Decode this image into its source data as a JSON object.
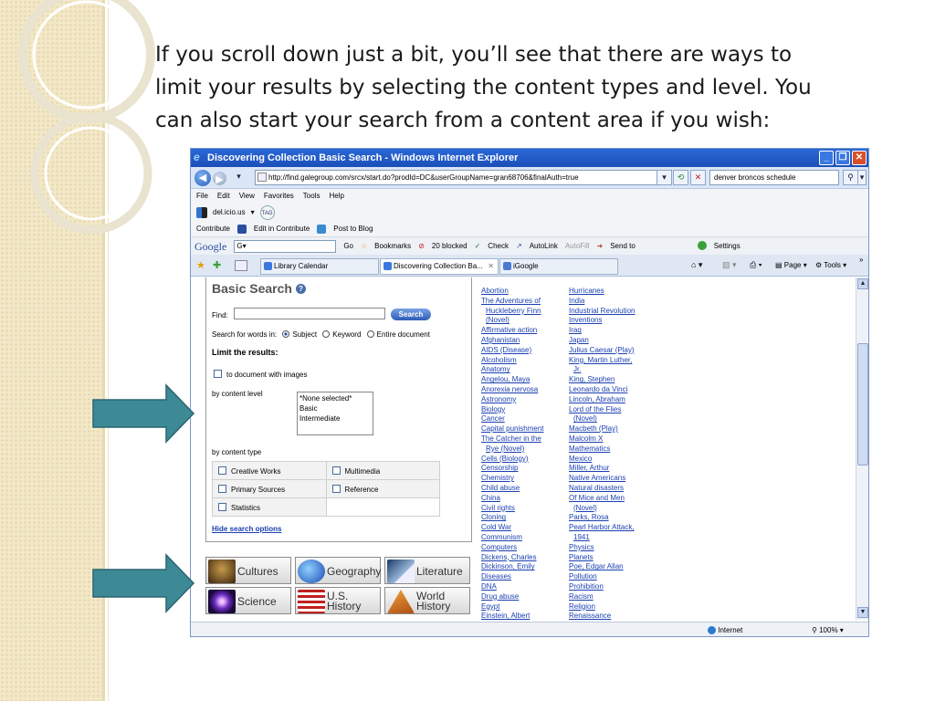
{
  "slide": {
    "title_lines": [
      "If you scroll down just a bit, you’ll see that there are ways to",
      "limit your results by selecting the content types and level. You",
      "can also start your search from a content area if you wish:"
    ]
  },
  "browser": {
    "window_title": "Discovering Collection Basic Search - Windows Internet Explorer",
    "url": "http://find.galegroup.com/srcx/start.do?prodId=DC&userGroupName=gran68706&finalAuth=true",
    "search_value": "denver broncos schedule",
    "menu": [
      "File",
      "Edit",
      "View",
      "Favorites",
      "Tools",
      "Help"
    ],
    "delicious": {
      "label": "del.icio.us",
      "tag": "TAG"
    },
    "contribute": {
      "label": "Contribute",
      "edit": "Edit in Contribute",
      "post": "Post to Blog"
    },
    "google": {
      "logo": "Google",
      "g": "G",
      "go": "Go",
      "bookmarks": "Bookmarks",
      "blocked": "20 blocked",
      "check": "Check",
      "autolink": "AutoLink",
      "autofill": "AutoFill",
      "sendto": "Send to",
      "settings": "Settings"
    },
    "tabs": [
      {
        "label": "Library Calendar"
      },
      {
        "label": "Discovering Collection Ba..."
      },
      {
        "label": "iGoogle"
      }
    ],
    "commands": {
      "page": "Page",
      "tools": "Tools"
    },
    "status": {
      "zone": "Internet",
      "zoom": "100%"
    }
  },
  "form": {
    "title": "Basic Search",
    "find_label": "Find:",
    "search_button": "Search",
    "search_words_in": "Search for words in:",
    "options": [
      "Subject",
      "Keyword",
      "Entire document"
    ],
    "limit_label": "Limit the results:",
    "images_checkbox": "to document with images",
    "level_label": "by content level",
    "levels": [
      "*None selected*",
      "Basic",
      "Intermediate"
    ],
    "type_label": "by content type",
    "types": [
      [
        "Creative Works",
        "Multimedia"
      ],
      [
        "Primary Sources",
        "Reference"
      ],
      [
        "Statistics",
        ""
      ]
    ],
    "hide_link": "Hide search options"
  },
  "categories": [
    {
      "label": "Cultures",
      "color": "#6b4a2a"
    },
    {
      "label": "Geography",
      "color": "#2a63c8"
    },
    {
      "label": "Literature",
      "color": "#3a6aa0"
    },
    {
      "label": "Science",
      "color": "#4a2a8a"
    },
    {
      "label": "U.S.",
      "label2": "History",
      "color": "#b03030"
    },
    {
      "label": "World",
      "label2": "History",
      "color": "#c8702a"
    }
  ],
  "topics_col1": [
    "Abortion",
    "The Adventures of",
    "  Huckleberry Finn",
    "  (Novel)",
    "Affirmative action",
    "Afghanistan",
    "AIDS (Disease)",
    "Alcoholism",
    "Anatomy",
    "Angelou, Maya",
    "Anorexia nervosa",
    "Astronomy",
    "Biology",
    "Cancer",
    "Capital punishment",
    "The Catcher in the",
    "  Rye (Novel)",
    "Cells (Biology)",
    "Censorship",
    "Chemistry",
    "Child abuse",
    "China",
    "Civil rights",
    "Cloning",
    "Cold War",
    "Communism",
    "Computers",
    "Dickens, Charles",
    "Dickinson, Emily",
    "Diseases",
    "DNA",
    "Drug abuse",
    "Egypt",
    "Einstein, Albert"
  ],
  "topics_col2": [
    "Hurricanes",
    "India",
    "Industrial Revolution",
    "Inventions",
    "Iraq",
    "Japan",
    "Julius Caesar (Play)",
    "King, Martin Luther,",
    "  Jr.",
    "King, Stephen",
    "Leonardo da Vinci",
    "Lincoln, Abraham",
    "Lord of the Flies",
    "  (Novel)",
    "Macbeth (Play)",
    "Malcolm X",
    "Mathematics",
    "Mexico",
    "Miller, Arthur",
    "Native Americans",
    "Natural disasters",
    "Of Mice and Men",
    "  (Novel)",
    "Parks, Rosa",
    "Pearl Harbor Attack,",
    "  1941",
    "Physics",
    "Planets",
    "Poe, Edgar Allan",
    "Pollution",
    "Prohibition",
    "Racism",
    "Religion",
    "Renaissance"
  ]
}
